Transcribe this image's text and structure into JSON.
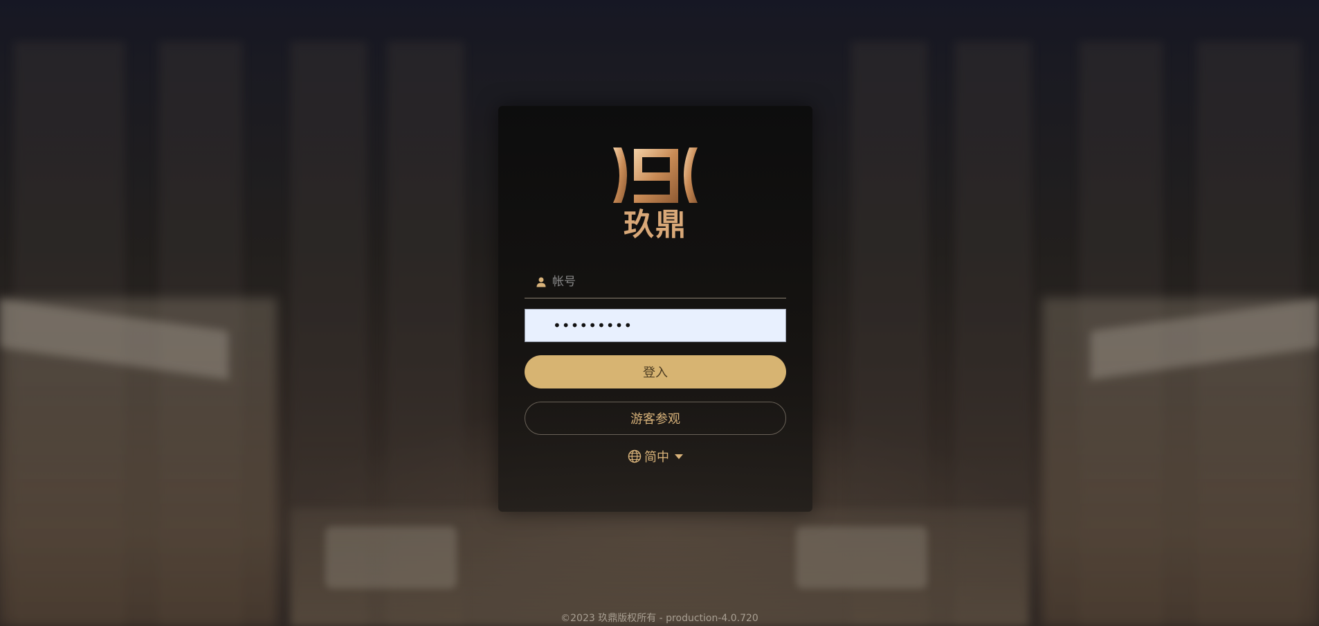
{
  "brand": {
    "logo_text": "玖鼎",
    "accent_color": "#d9a878"
  },
  "login": {
    "username_placeholder": "帐号",
    "password_value": "•••••••••",
    "login_button": "登入",
    "guest_button": "游客参观",
    "language": "简中"
  },
  "footer": {
    "copyright": "©2023 玖鼎版权所有 - production-4.0.720"
  },
  "icons": {
    "user": "user-icon",
    "globe": "globe-icon",
    "caret": "caret-down-icon"
  }
}
